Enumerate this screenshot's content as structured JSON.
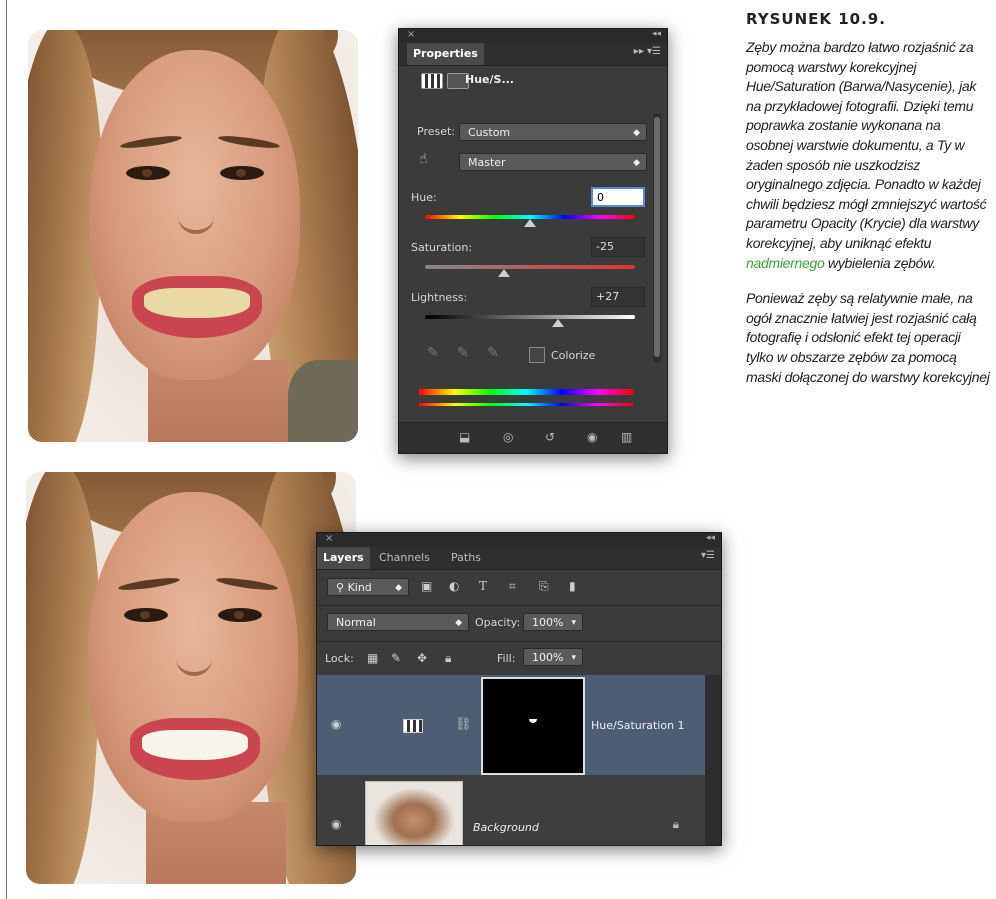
{
  "figure": {
    "label": "RYSUNEK 10.9.",
    "para1_before": "Zęby można bardzo łatwo rozjaśnić za pomocą warstwy korekcyjnej Hue/Saturation (Barwa/Nasycenie), jak na przykładowej fotografii. Dzięki temu poprawka zostanie wykonana na osobnej warstwie dokumentu, a Ty w żaden sposób nie uszkodzisz oryginalnego zdjęcia. Ponadto w każdej chwili będziesz mógł zmniejszyć wartość parametru Opacity (Krycie) dla warstwy korekcyjnej, aby uniknąć efektu ",
    "para1_highlight": "nadmiernego",
    "para1_after": " wybielenia zębów.",
    "para2": "Ponieważ zęby są relatywnie małe, na ogół znacznie łatwiej jest rozjaśnić całą fotografię i odsłonić efekt tej operacji tylko w obszarze zębów za pomocą maski dołączonej do warstwy korekcyjnej",
    "highlight_color": "#3c9f3c"
  },
  "properties_panel": {
    "close_glyph": "×",
    "collapse_glyph": "◂◂",
    "tab": "Properties",
    "tab_menu_glyph": "▸▸ ▾☰",
    "title": "Hue/S...",
    "preset_label": "Preset:",
    "preset_value": "Custom",
    "channel_value": "Master",
    "hue_label": "Hue:",
    "hue_value": "0",
    "saturation_label": "Saturation:",
    "saturation_value": "-25",
    "lightness_label": "Lightness:",
    "lightness_value": "+27",
    "colorize_label": "Colorize",
    "icons": [
      "adjustment-icon",
      "mask-icon",
      "targeted-adjustment-hand-icon",
      "eyedropper-icon",
      "eyedropper-plus-icon",
      "eyedropper-minus-icon",
      "clip-to-layer-icon",
      "view-previous-icon",
      "reset-icon",
      "visibility-icon",
      "trash-icon"
    ],
    "sliders": {
      "hue_fraction": 0.5,
      "saturation_fraction": 0.375,
      "lightness_fraction": 0.635
    }
  },
  "layers_panel": {
    "close_glyph": "×",
    "collapse_glyph": "◂◂",
    "tabs": [
      "Layers",
      "Channels",
      "Paths"
    ],
    "menu_glyph": "▾☰",
    "filter_kind": "Kind",
    "filter_icons": [
      "image-filter-icon",
      "adjustment-filter-icon",
      "type-filter-icon",
      "shape-filter-icon",
      "smart-object-filter-icon",
      "filter-toggle-icon"
    ],
    "blend_mode": "Normal",
    "opacity_label": "Opacity:",
    "opacity_value": "100%",
    "lock_label": "Lock:",
    "fill_label": "Fill:",
    "fill_value": "100%",
    "layers": [
      {
        "name": "Hue/Saturation 1",
        "selected": true
      },
      {
        "name": "Background",
        "selected": false
      }
    ]
  }
}
